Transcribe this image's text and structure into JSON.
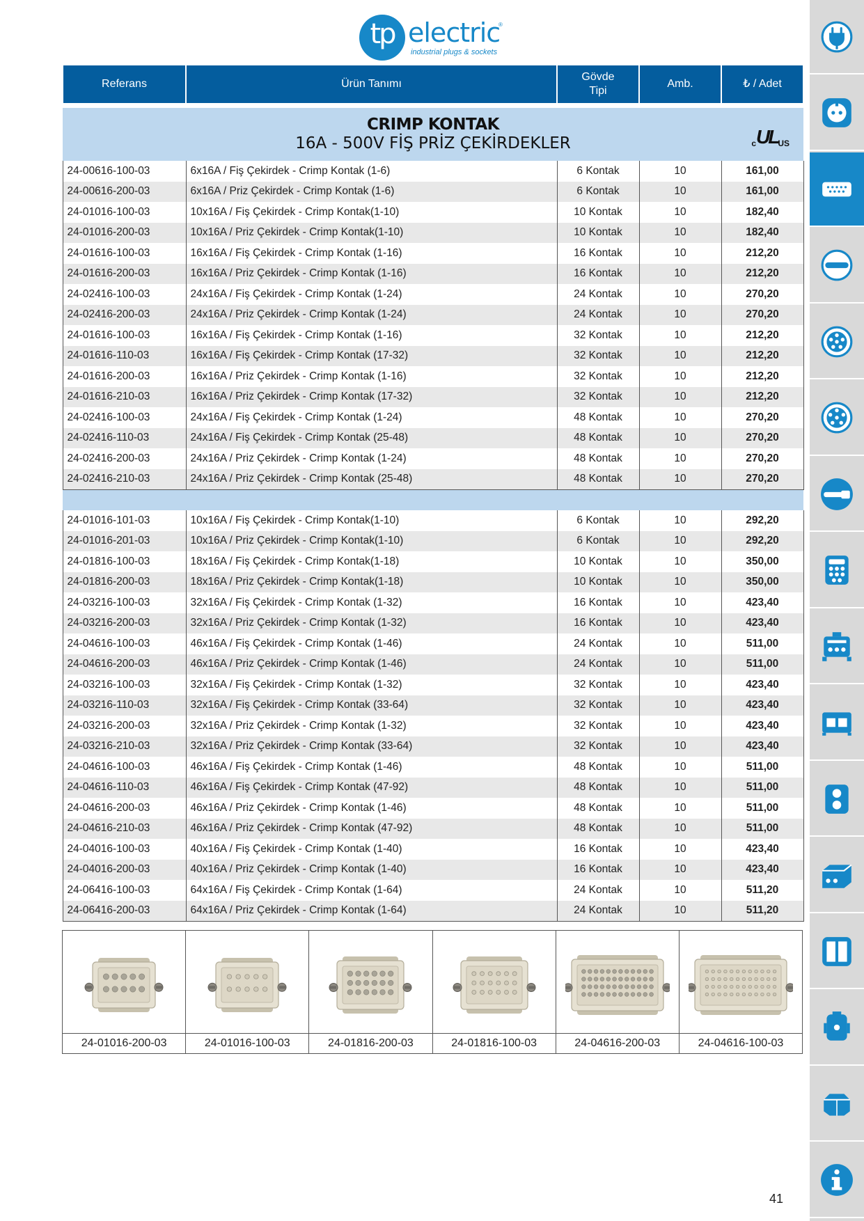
{
  "brand": {
    "prefix": "tp",
    "name": "electric",
    "reg": "®",
    "tagline": "industrial plugs & sockets"
  },
  "table": {
    "headers": {
      "ref": "Referans",
      "desc": "Ürün Tanımı",
      "body_line1": "Gövde",
      "body_line2": "Tipi",
      "pack": "Amb.",
      "price": "₺ / Adet"
    },
    "section": {
      "title": "CRIMP KONTAK",
      "subtitle": "16A - 500V FİŞ PRİZ ÇEKİRDEKLER",
      "cert": {
        "c": "c",
        "ul": "UL",
        "us": "US"
      }
    },
    "group1": [
      {
        "ref": "24-00616-100-03",
        "desc": "6x16A / Fiş Çekirdek - Crimp Kontak (1-6)",
        "body": "6 Kontak",
        "pack": "10",
        "price": "161,00"
      },
      {
        "ref": "24-00616-200-03",
        "desc": "6x16A / Priz Çekirdek - Crimp Kontak (1-6)",
        "body": "6 Kontak",
        "pack": "10",
        "price": "161,00"
      },
      {
        "ref": "24-01016-100-03",
        "desc": "10x16A / Fiş Çekirdek - Crimp Kontak(1-10)",
        "body": "10 Kontak",
        "pack": "10",
        "price": "182,40"
      },
      {
        "ref": "24-01016-200-03",
        "desc": "10x16A / Priz Çekirdek - Crimp Kontak(1-10)",
        "body": "10 Kontak",
        "pack": "10",
        "price": "182,40"
      },
      {
        "ref": "24-01616-100-03",
        "desc": "16x16A / Fiş Çekirdek - Crimp Kontak (1-16)",
        "body": "16 Kontak",
        "pack": "10",
        "price": "212,20"
      },
      {
        "ref": "24-01616-200-03",
        "desc": "16x16A / Priz Çekirdek - Crimp Kontak (1-16)",
        "body": "16 Kontak",
        "pack": "10",
        "price": "212,20"
      },
      {
        "ref": "24-02416-100-03",
        "desc": "24x16A / Fiş Çekirdek - Crimp Kontak (1-24)",
        "body": "24 Kontak",
        "pack": "10",
        "price": "270,20"
      },
      {
        "ref": "24-02416-200-03",
        "desc": "24x16A / Priz Çekirdek - Crimp Kontak (1-24)",
        "body": "24 Kontak",
        "pack": "10",
        "price": "270,20"
      },
      {
        "ref": "24-01616-100-03",
        "desc": "16x16A / Fiş Çekirdek - Crimp Kontak  (1-16)",
        "body": "32 Kontak",
        "pack": "10",
        "price": "212,20"
      },
      {
        "ref": "24-01616-110-03",
        "desc": "16x16A / Fiş Çekirdek - Crimp Kontak  (17-32)",
        "body": "32 Kontak",
        "pack": "10",
        "price": "212,20"
      },
      {
        "ref": "24-01616-200-03",
        "desc": "16x16A / Priz Çekirdek - Crimp Kontak  (1-16)",
        "body": "32 Kontak",
        "pack": "10",
        "price": "212,20"
      },
      {
        "ref": "24-01616-210-03",
        "desc": "16x16A / Priz Çekirdek - Crimp Kontak  (17-32)",
        "body": "32 Kontak",
        "pack": "10",
        "price": "212,20"
      },
      {
        "ref": "24-02416-100-03",
        "desc": "24x16A / Fiş Çekirdek - Crimp Kontak (1-24)",
        "body": "48 Kontak",
        "pack": "10",
        "price": "270,20"
      },
      {
        "ref": "24-02416-110-03",
        "desc": "24x16A / Fiş Çekirdek - Crimp Kontak (25-48)",
        "body": "48 Kontak",
        "pack": "10",
        "price": "270,20"
      },
      {
        "ref": "24-02416-200-03",
        "desc": "24x16A / Priz Çekirdek - Crimp Kontak (1-24)",
        "body": "48 Kontak",
        "pack": "10",
        "price": "270,20"
      },
      {
        "ref": "24-02416-210-03",
        "desc": "24x16A / Priz Çekirdek - Crimp Kontak (25-48)",
        "body": "48 Kontak",
        "pack": "10",
        "price": "270,20"
      }
    ],
    "group2": [
      {
        "ref": "24-01016-101-03",
        "desc": "10x16A / Fiş Çekirdek - Crimp Kontak(1-10)",
        "body": "6 Kontak",
        "pack": "10",
        "price": "292,20"
      },
      {
        "ref": "24-01016-201-03",
        "desc": "10x16A / Priz Çekirdek - Crimp Kontak(1-10)",
        "body": "6 Kontak",
        "pack": "10",
        "price": "292,20"
      },
      {
        "ref": "24-01816-100-03",
        "desc": "18x16A / Fiş Çekirdek - Crimp Kontak(1-18)",
        "body": "10 Kontak",
        "pack": "10",
        "price": "350,00"
      },
      {
        "ref": "24-01816-200-03",
        "desc": "18x16A / Priz Çekirdek - Crimp Kontak(1-18)",
        "body": "10 Kontak",
        "pack": "10",
        "price": "350,00"
      },
      {
        "ref": "24-03216-100-03",
        "desc": "32x16A / Fiş Çekirdek - Crimp Kontak  (1-32)",
        "body": "16 Kontak",
        "pack": "10",
        "price": "423,40"
      },
      {
        "ref": "24-03216-200-03",
        "desc": "32x16A / Priz Çekirdek - Crimp Kontak  (1-32)",
        "body": "16 Kontak",
        "pack": "10",
        "price": "423,40"
      },
      {
        "ref": "24-04616-100-03",
        "desc": "46x16A / Fiş Çekirdek - Crimp Kontak  (1-46)",
        "body": "24 Kontak",
        "pack": "10",
        "price": "511,00"
      },
      {
        "ref": "24-04616-200-03",
        "desc": "46x16A / Priz Çekirdek - Crimp Kontak  (1-46)",
        "body": "24 Kontak",
        "pack": "10",
        "price": "511,00"
      },
      {
        "ref": "24-03216-100-03",
        "desc": "32x16A / Fiş Çekirdek - Crimp Kontak  (1-32)",
        "body": "32 Kontak",
        "pack": "10",
        "price": "423,40"
      },
      {
        "ref": "24-03216-110-03",
        "desc": "32x16A / Fiş Çekirdek - Crimp Kontak  (33-64)",
        "body": "32 Kontak",
        "pack": "10",
        "price": "423,40"
      },
      {
        "ref": "24-03216-200-03",
        "desc": "32x16A / Priz Çekirdek - Crimp Kontak  (1-32)",
        "body": "32 Kontak",
        "pack": "10",
        "price": "423,40"
      },
      {
        "ref": "24-03216-210-03",
        "desc": "32x16A / Priz Çekirdek - Crimp Kontak  (33-64)",
        "body": "32 Kontak",
        "pack": "10",
        "price": "423,40"
      },
      {
        "ref": "24-04616-100-03",
        "desc": "46x16A / Fiş Çekirdek - Crimp Kontak  (1-46)",
        "body": "48 Kontak",
        "pack": "10",
        "price": "511,00"
      },
      {
        "ref": "24-04616-110-03",
        "desc": "46x16A / Fiş Çekirdek - Crimp Kontak  (47-92)",
        "body": "48 Kontak",
        "pack": "10",
        "price": "511,00"
      },
      {
        "ref": "24-04616-200-03",
        "desc": "46x16A / Priz Çekirdek - Crimp Kontak  (1-46)",
        "body": "48 Kontak",
        "pack": "10",
        "price": "511,00"
      },
      {
        "ref": "24-04616-210-03",
        "desc": "46x16A / Priz Çekirdek - Crimp Kontak  (47-92)",
        "body": "48 Kontak",
        "pack": "10",
        "price": "511,00"
      },
      {
        "ref": "24-04016-100-03",
        "desc": "40x16A / Fiş Çekirdek - Crimp Kontak  (1-40)",
        "body": "16 Kontak",
        "pack": "10",
        "price": "423,40"
      },
      {
        "ref": "24-04016-200-03",
        "desc": "40x16A / Priz Çekirdek - Crimp Kontak  (1-40)",
        "body": "16 Kontak",
        "pack": "10",
        "price": "423,40"
      },
      {
        "ref": "24-06416-100-03",
        "desc": "64x16A / Fiş Çekirdek - Crimp Kontak  (1-64)",
        "body": "24 Kontak",
        "pack": "10",
        "price": "511,20"
      },
      {
        "ref": "24-06416-200-03",
        "desc": "64x16A / Priz Çekirdek - Crimp Kontak  (1-64)",
        "body": "24 Kontak",
        "pack": "10",
        "price": "511,20"
      }
    ]
  },
  "products": [
    {
      "label": "24-01016-200-03",
      "kind": "socket",
      "rows": 2,
      "cols": 5,
      "icon": "socket-insert-image"
    },
    {
      "label": "24-01016-100-03",
      "kind": "plug",
      "rows": 2,
      "cols": 5,
      "icon": "plug-insert-image"
    },
    {
      "label": "24-01816-200-03",
      "kind": "socket",
      "rows": 3,
      "cols": 6,
      "icon": "socket-insert-image"
    },
    {
      "label": "24-01816-100-03",
      "kind": "plug",
      "rows": 3,
      "cols": 6,
      "icon": "plug-insert-image"
    },
    {
      "label": "24-04616-200-03",
      "kind": "socket",
      "rows": 4,
      "cols": 12,
      "icon": "socket-insert-image"
    },
    {
      "label": "24-04616-100-03",
      "kind": "plug",
      "rows": 4,
      "cols": 12,
      "icon": "plug-insert-image"
    }
  ],
  "sidebar": {
    "active_index": 2,
    "items": [
      {
        "icon": "plug-icon"
      },
      {
        "icon": "socket-icon"
      },
      {
        "icon": "connector-insert-icon"
      },
      {
        "icon": "cable-entry-icon"
      },
      {
        "icon": "multi-pin-socket-icon"
      },
      {
        "icon": "multi-pin-socket-2-icon"
      },
      {
        "icon": "cable-plug-icon"
      },
      {
        "icon": "distribution-box-icon"
      },
      {
        "icon": "panel-box-icon"
      },
      {
        "icon": "dual-socket-box-icon"
      },
      {
        "icon": "wall-box-icon"
      },
      {
        "icon": "enclosure-icon"
      },
      {
        "icon": "double-door-cabinet-icon"
      },
      {
        "icon": "cylinder-enclosure-icon"
      },
      {
        "icon": "hexagon-enclosure-icon"
      },
      {
        "icon": "info-icon"
      }
    ]
  },
  "colors": {
    "header": "#045d9e",
    "section": "#bdd7ee",
    "accent": "#1788c8",
    "row_alt": "#e8e8e8",
    "sidebar": "#d9d9d9"
  },
  "page_number": "41"
}
